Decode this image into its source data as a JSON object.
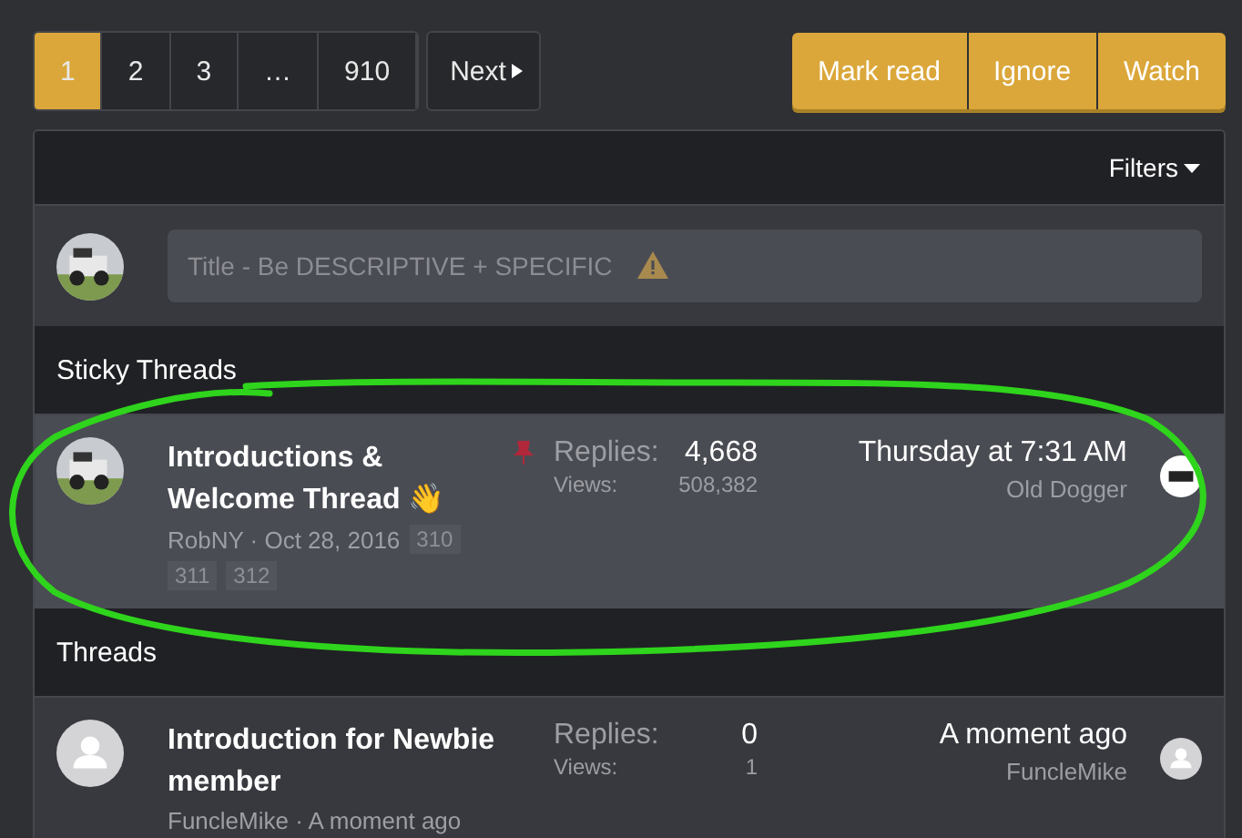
{
  "pagination": {
    "pages": [
      {
        "label": "1",
        "selected": true
      },
      {
        "label": "2",
        "selected": false
      },
      {
        "label": "3",
        "selected": false
      },
      {
        "label": "…",
        "selected": false
      },
      {
        "label": "910",
        "selected": false
      }
    ],
    "next": "Next"
  },
  "actions": [
    "Mark read",
    "Ignore",
    "Watch"
  ],
  "filters": "Filters",
  "composer": {
    "placeholder": "Title - Be DESCRIPTIVE + SPECIFIC"
  },
  "sections": [
    {
      "title": "Sticky Threads",
      "threads": [
        {
          "title": "Introductions & Welcome Thread",
          "emoji": "👋",
          "pinned": true,
          "sticky": true,
          "meta": "RobNY · Oct 28, 2016",
          "pages": [
            "310",
            "311",
            "312"
          ],
          "replies_label": "Replies:",
          "replies": "4,668",
          "views_label": "Views:",
          "views": "508,382",
          "last_time": "Thursday at 7:31 AM",
          "last_user": "Old Dogger",
          "last_avatar": {
            "kind": "logo"
          }
        }
      ]
    },
    {
      "title": "Threads",
      "threads": [
        {
          "title": "Introduction for Newbie member",
          "pinned": false,
          "sticky": false,
          "avatar": {
            "kind": "default"
          },
          "meta": "FuncleMike · A moment ago",
          "replies_label": "Replies:",
          "replies": "0",
          "views_label": "Views:",
          "views": "1",
          "last_time": "A moment ago",
          "last_user": "FuncleMike",
          "last_avatar": {
            "kind": "default"
          }
        }
      ]
    }
  ],
  "highlight_mark": {
    "shown": true,
    "color": "#2fd41c"
  }
}
